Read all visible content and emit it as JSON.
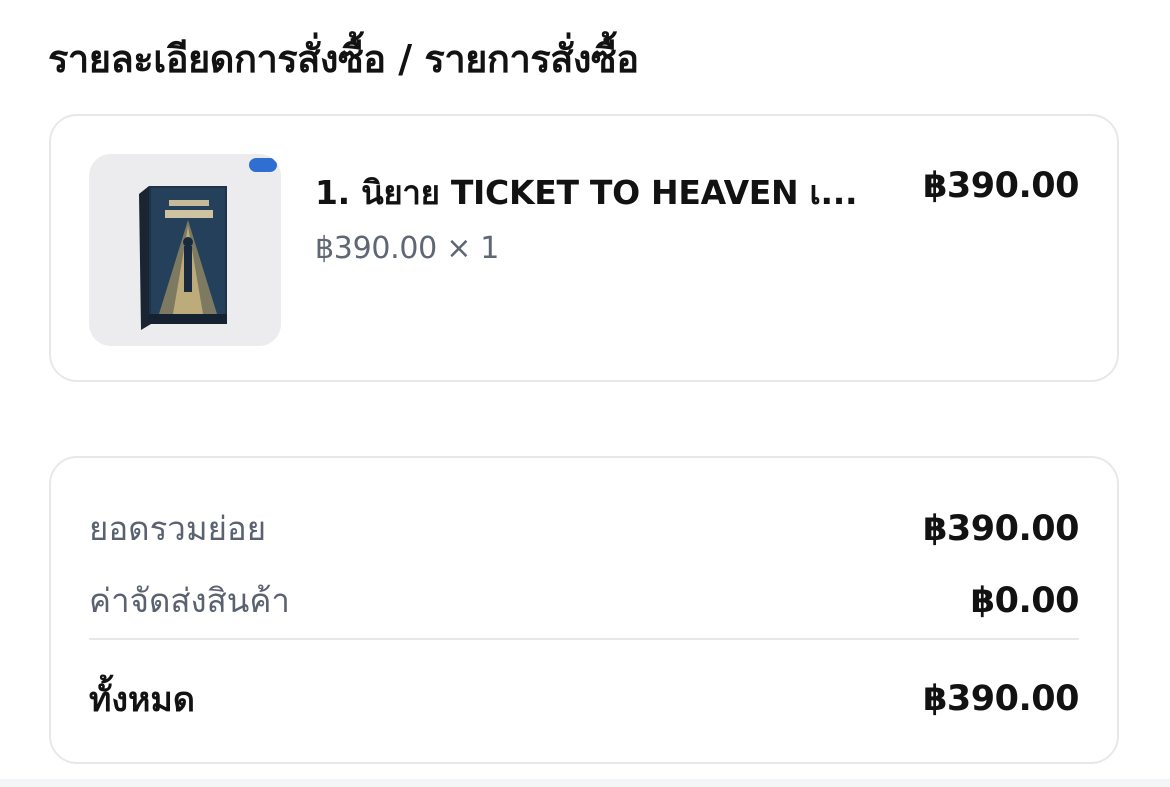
{
  "header": {
    "title": "รายละเอียดการสั่งซื้อ / รายการสั่งซื้อ"
  },
  "order_items": [
    {
      "name": "1. นิยาย TICKET TO HEAVEN เ...",
      "line_total": "฿390.00",
      "unit_price_qty": "฿390.00 × 1",
      "thumbnail_icon": "book-cover-icon"
    }
  ],
  "summary": {
    "subtotal_label": "ยอดรวมย่อย",
    "subtotal_value": "฿390.00",
    "shipping_label": "ค่าจัดส่งสินค้า",
    "shipping_value": "฿0.00",
    "total_label": "ทั้งหมด",
    "total_value": "฿390.00"
  },
  "colors": {
    "border": "#e6e8ec",
    "muted_text": "#5a6170",
    "primary_text": "#121212",
    "thumb_bg": "#ececee"
  }
}
